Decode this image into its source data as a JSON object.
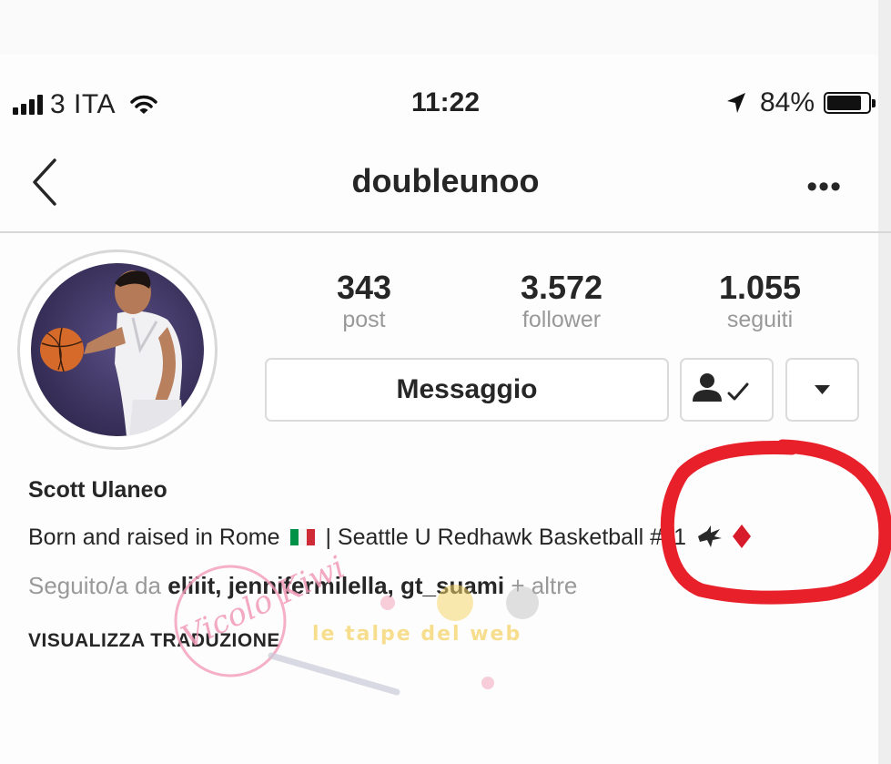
{
  "status_bar": {
    "carrier": "3 ITA",
    "time": "11:22",
    "battery": "84%",
    "battery_level": 0.84,
    "icons": [
      "signal-bars-icon",
      "wifi-icon",
      "location-arrow-icon",
      "battery-icon"
    ]
  },
  "nav": {
    "title": "doubleunoo",
    "back_icon": "chevron-left-icon",
    "more_icon": "more-dots-icon",
    "more_label": "•••"
  },
  "profile": {
    "stats": [
      {
        "value": "343",
        "label": "post"
      },
      {
        "value": "3.572",
        "label": "follower"
      },
      {
        "value": "1.055",
        "label": "seguiti"
      }
    ],
    "message_button": "Messaggio",
    "name": "Scott Ulaneo",
    "bio_before_flag": "Born and raised in Rome",
    "bio_after_flag": "| Seattle U Redhawk Basketball #11",
    "followed_prefix": "Seguito/a da",
    "followed_names": "eliiit, jennifermilella, gt_suami",
    "followed_suffix": "+ altre",
    "translate": "VISUALIZZA TRADUZIONE"
  },
  "watermark": {
    "signature": "Vicolo Kiwi",
    "brand": "le talpe del web"
  },
  "colors": {
    "annotation_red": "#e8202a",
    "flag": [
      "#009246",
      "#ffffff",
      "#ce2b37"
    ],
    "diamond": "#d81b2a"
  }
}
